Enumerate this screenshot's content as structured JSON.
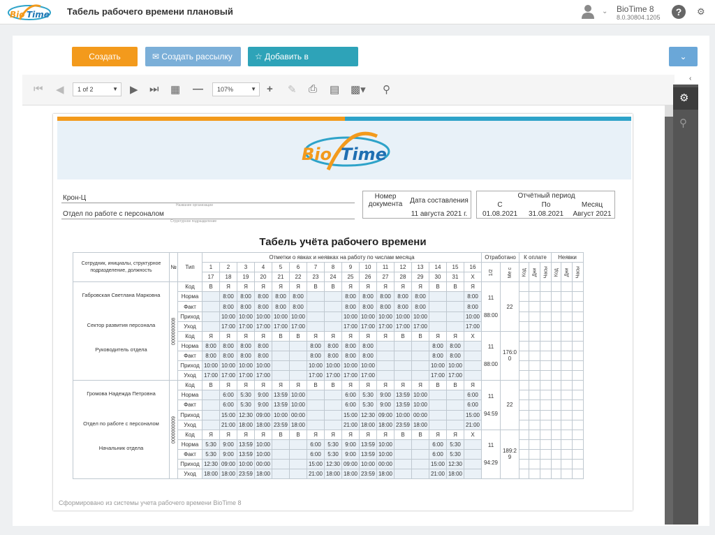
{
  "app": {
    "title": "Табель рабочего времени плановый",
    "name": "BioTime 8",
    "version": "8.0.30804.1205",
    "logo_text": "BioTime"
  },
  "actions": {
    "create_report": "Создать отчёт",
    "create_mailing": "Создать рассылку",
    "add_favorite": "Добавить в избранное"
  },
  "toolbar": {
    "page": "1 of 2",
    "zoom": "107%"
  },
  "colors": {
    "orange": "#f39a1c",
    "blue": "#2ea3c9",
    "teal": "#2ea3b8"
  },
  "report": {
    "org_name": "Крон-Ц",
    "org_caption": "Название организации",
    "department": "Отдел по работе с персоналом",
    "department_caption": "Структурное подразделение",
    "doc_number_label": "Номер документа",
    "doc_date_label": "Дата составления",
    "doc_date": "11 августа 2021 г.",
    "period_label": "Отчётный период",
    "from_label": "С",
    "to_label": "По",
    "month_label": "Месяц",
    "from": "01.08.2021",
    "to": "31.08.2021",
    "month": "Август 2021",
    "title": "Табель учёта рабочего времени",
    "footer": "Сформировано из системы учета рабочего времени BioTime 8"
  },
  "table": {
    "h_employee": "Сотрудник, инициалы, структурное подразделение, должность",
    "h_num": "№",
    "h_type": "Тип",
    "h_marks": "Отметки о явках и неявках на работу по числам месяца",
    "h_worked": "Отработано",
    "h_pay": "К оплате",
    "h_absence": "Неявки",
    "h_half": "1/2",
    "h_month": "Ме с",
    "h_code": "Код",
    "h_days": "Дни",
    "h_hours": "Часы",
    "days1": [
      "1",
      "2",
      "3",
      "4",
      "5",
      "6",
      "7",
      "8",
      "9",
      "10",
      "11",
      "12",
      "13",
      "14",
      "15",
      "16"
    ],
    "days2": [
      "17",
      "18",
      "19",
      "20",
      "21",
      "22",
      "23",
      "24",
      "25",
      "26",
      "27",
      "28",
      "29",
      "30",
      "31",
      "X"
    ],
    "employees": [
      {
        "name": "Габровская Светлана Марковна",
        "dept": "Сектор развития персонала",
        "position": "Руководитель отдела",
        "number": "0000000008",
        "half1_days": "11",
        "half1_hours": "88:00",
        "half2_days": "11",
        "half2_hours": "88:00",
        "month_days": "22",
        "month_hours": "176:0 0",
        "rows": [
          {
            "type": "Код",
            "c": [
              "В",
              "Я",
              "Я",
              "Я",
              "Я",
              "Я",
              "В",
              "В",
              "Я",
              "Я",
              "Я",
              "Я",
              "Я",
              "В",
              "В",
              "Я"
            ]
          },
          {
            "type": "Норма",
            "c": [
              "",
              "8:00",
              "8:00",
              "8:00",
              "8:00",
              "8:00",
              "",
              "",
              "8:00",
              "8:00",
              "8:00",
              "8:00",
              "8:00",
              "",
              "",
              "8:00"
            ]
          },
          {
            "type": "Факт",
            "c": [
              "",
              "8:00",
              "8:00",
              "8:00",
              "8:00",
              "8:00",
              "",
              "",
              "8:00",
              "8:00",
              "8:00",
              "8:00",
              "8:00",
              "",
              "",
              "8:00"
            ]
          },
          {
            "type": "Приход",
            "c": [
              "",
              "10:00",
              "10:00",
              "10:00",
              "10:00",
              "10:00",
              "",
              "",
              "10:00",
              "10:00",
              "10:00",
              "10:00",
              "10:00",
              "",
              "",
              "10:00"
            ]
          },
          {
            "type": "Уход",
            "c": [
              "",
              "17:00",
              "17:00",
              "17:00",
              "17:00",
              "17:00",
              "",
              "",
              "17:00",
              "17:00",
              "17:00",
              "17:00",
              "17:00",
              "",
              "",
              "17:00"
            ]
          },
          {
            "type": "Код",
            "c": [
              "Я",
              "Я",
              "Я",
              "Я",
              "В",
              "В",
              "Я",
              "Я",
              "Я",
              "Я",
              "Я",
              "В",
              "В",
              "Я",
              "Я",
              "X"
            ]
          },
          {
            "type": "Норма",
            "c": [
              "8:00",
              "8:00",
              "8:00",
              "8:00",
              "",
              "",
              "8:00",
              "8:00",
              "8:00",
              "8:00",
              "",
              "",
              "",
              "8:00",
              "8:00",
              ""
            ]
          },
          {
            "type": "Факт",
            "c": [
              "8:00",
              "8:00",
              "8:00",
              "8:00",
              "",
              "",
              "8:00",
              "8:00",
              "8:00",
              "8:00",
              "",
              "",
              "",
              "8:00",
              "8:00",
              ""
            ]
          },
          {
            "type": "Приход",
            "c": [
              "10:00",
              "10:00",
              "10:00",
              "10:00",
              "",
              "",
              "10:00",
              "10:00",
              "10:00",
              "10:00",
              "",
              "",
              "",
              "10:00",
              "10:00",
              ""
            ]
          },
          {
            "type": "Уход",
            "c": [
              "17:00",
              "17:00",
              "17:00",
              "17:00",
              "",
              "",
              "17:00",
              "17:00",
              "17:00",
              "17:00",
              "",
              "",
              "",
              "17:00",
              "17:00",
              ""
            ]
          }
        ]
      },
      {
        "name": "Громова Надежда Петровна",
        "dept": "Отдел по работе с персоналом",
        "position": "Начальник отдела",
        "number": "0000000009",
        "half1_days": "11",
        "half1_hours": "94:59",
        "half2_days": "11",
        "half2_hours": "94:29",
        "month_days": "22",
        "month_hours": "189:2 9",
        "rows": [
          {
            "type": "Код",
            "c": [
              "В",
              "Я",
              "Я",
              "Я",
              "Я",
              "Я",
              "В",
              "В",
              "Я",
              "Я",
              "Я",
              "Я",
              "Я",
              "В",
              "В",
              "Я"
            ]
          },
          {
            "type": "Норма",
            "c": [
              "",
              "6:00",
              "5:30",
              "9:00",
              "13:59",
              "10:00",
              "",
              "",
              "6:00",
              "5:30",
              "9:00",
              "13:59",
              "10:00",
              "",
              "",
              "6:00"
            ]
          },
          {
            "type": "Факт",
            "c": [
              "",
              "6:00",
              "5:30",
              "9:00",
              "13:59",
              "10:00",
              "",
              "",
              "6:00",
              "5:30",
              "9:00",
              "13:59",
              "10:00",
              "",
              "",
              "6:00"
            ]
          },
          {
            "type": "Приход",
            "c": [
              "",
              "15:00",
              "12:30",
              "09:00",
              "10:00",
              "00:00",
              "",
              "",
              "15:00",
              "12:30",
              "09:00",
              "10:00",
              "00:00",
              "",
              "",
              "15:00"
            ]
          },
          {
            "type": "Уход",
            "c": [
              "",
              "21:00",
              "18:00",
              "18:00",
              "23:59",
              "18:00",
              "",
              "",
              "21:00",
              "18:00",
              "18:00",
              "23:59",
              "18:00",
              "",
              "",
              "21:00"
            ]
          },
          {
            "type": "Код",
            "c": [
              "Я",
              "Я",
              "Я",
              "Я",
              "В",
              "В",
              "Я",
              "Я",
              "Я",
              "Я",
              "Я",
              "В",
              "В",
              "Я",
              "Я",
              "X"
            ]
          },
          {
            "type": "Норма",
            "c": [
              "5:30",
              "9:00",
              "13:59",
              "10:00",
              "",
              "",
              "6:00",
              "5:30",
              "9:00",
              "13:59",
              "10:00",
              "",
              "",
              "6:00",
              "5:30",
              ""
            ]
          },
          {
            "type": "Факт",
            "c": [
              "5:30",
              "9:00",
              "13:59",
              "10:00",
              "",
              "",
              "6:00",
              "5:30",
              "9:00",
              "13:59",
              "10:00",
              "",
              "",
              "6:00",
              "5:30",
              ""
            ]
          },
          {
            "type": "Приход",
            "c": [
              "12:30",
              "09:00",
              "10:00",
              "00:00",
              "",
              "",
              "15:00",
              "12:30",
              "09:00",
              "10:00",
              "00:00",
              "",
              "",
              "15:00",
              "12:30",
              ""
            ]
          },
          {
            "type": "Уход",
            "c": [
              "18:00",
              "18:00",
              "23:59",
              "18:00",
              "",
              "",
              "21:00",
              "18:00",
              "18:00",
              "23:59",
              "18:00",
              "",
              "",
              "21:00",
              "18:00",
              ""
            ]
          }
        ]
      }
    ]
  }
}
